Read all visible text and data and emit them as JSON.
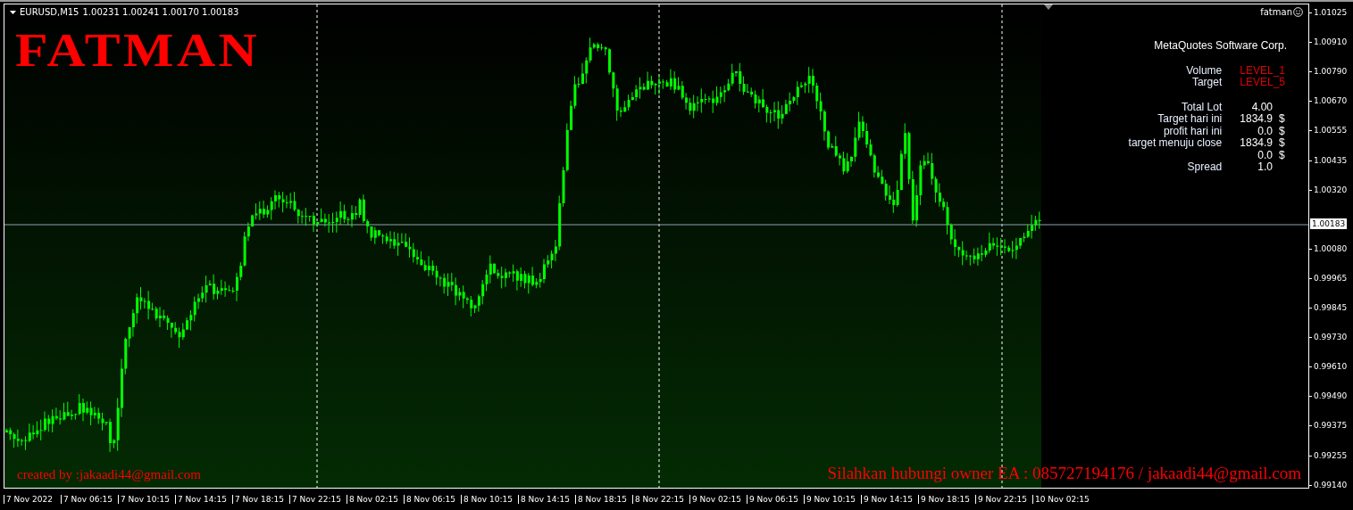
{
  "chart": {
    "symbol": "EURUSD,M15",
    "ohlc": "1.00231 1.00241 1.00170 1.00183",
    "logo": "FATMAN",
    "account": "fatman",
    "company": "MetaQuotes Software Corp.",
    "settings": [
      {
        "label": "Volume",
        "value": "LEVEL_1"
      },
      {
        "label": "Target",
        "value": "LEVEL_5"
      }
    ],
    "stats": [
      {
        "label": "Total Lot",
        "value": "4.00"
      },
      {
        "label": "Target hari ini",
        "value": "1834.9",
        "unit": "$"
      },
      {
        "label": "profit hari ini",
        "value": "0.0",
        "unit": "$"
      },
      {
        "label": "target menuju close",
        "value": "1834.9",
        "unit": "$"
      },
      {
        "value": "0.0",
        "unit": "$"
      },
      {
        "label": "Spread",
        "value": "1.0"
      }
    ],
    "credit": "created by :jakaadi44@gmail.com",
    "contact": "Silahkan hubungi owner EA : 085727194176 / jakaadi44@gmail.com"
  },
  "price_axis": {
    "ticks": [
      "1.01025",
      "1.00910",
      "1.00790",
      "1.00670",
      "1.00555",
      "1.00435",
      "1.00320",
      "1.00080",
      "0.99965",
      "0.99845",
      "0.99730",
      "0.99610",
      "0.99490",
      "0.99375",
      "0.99255",
      "0.99140"
    ],
    "current_price": "1.00183"
  },
  "time_axis": {
    "labels": [
      "7 Nov 2022",
      "7 Nov 06:15",
      "7 Nov 10:15",
      "7 Nov 14:15",
      "7 Nov 18:15",
      "7 Nov 22:15",
      "8 Nov 02:15",
      "8 Nov 06:15",
      "8 Nov 10:15",
      "8 Nov 14:15",
      "8 Nov 18:15",
      "8 Nov 22:15",
      "9 Nov 02:15",
      "9 Nov 06:15",
      "9 Nov 10:15",
      "9 Nov 14:15",
      "9 Nov 18:15",
      "9 Nov 22:15",
      "10 Nov 02:15"
    ]
  }
}
